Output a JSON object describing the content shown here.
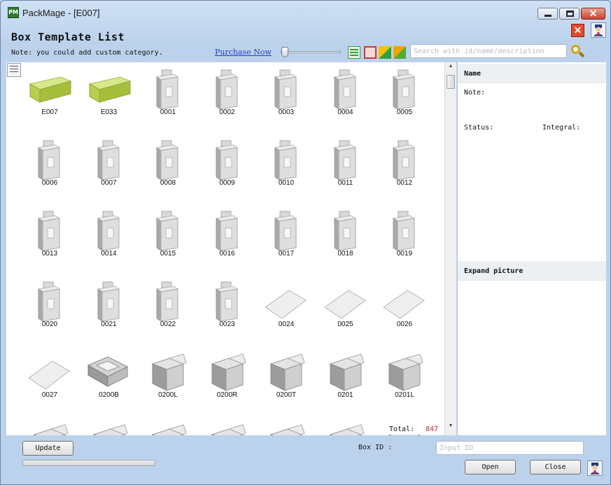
{
  "window": {
    "title": "PackMage - [E007]",
    "app_icon_text": "PM"
  },
  "header": {
    "title": "Box Template List",
    "note": "Note: you could add custom category.",
    "purchase_link": "Purchase Now",
    "search_placeholder": "Search with id/name/description"
  },
  "toolbar": {
    "zoom_level": 0.0,
    "icons": [
      "view-list-icon",
      "view-box-icon",
      "view-3d-icon",
      "view-3d2-icon",
      "search-icon"
    ]
  },
  "templates": [
    "E007",
    "E033",
    "0001",
    "0002",
    "0003",
    "0004",
    "0005",
    "0006",
    "0007",
    "0008",
    "0009",
    "0010",
    "0011",
    "0012",
    "0013",
    "0014",
    "0015",
    "0016",
    "0017",
    "0018",
    "0019",
    "0020",
    "0021",
    "0022",
    "0023",
    "0024",
    "0025",
    "0026",
    "0027",
    "0200B",
    "0200L",
    "0200R",
    "0200T",
    "0201",
    "0201L",
    "",
    "",
    "",
    "",
    "",
    "",
    ""
  ],
  "footer": {
    "total_label": "Total:",
    "total_value": "847",
    "update_label": "Update",
    "boxid_label": "Box ID :",
    "boxid_placeholder": "Input ID",
    "open_label": "Open",
    "close_label": "Close"
  },
  "info": {
    "name_label": "Name",
    "note_label": "Note:",
    "status_label": "Status:",
    "integral_label": "Integral:",
    "expand_label": "Expand picture"
  },
  "colors": {
    "accent_link": "#1f3fc5",
    "total_value": "#c0292b",
    "close_red": "#e04a2c"
  }
}
